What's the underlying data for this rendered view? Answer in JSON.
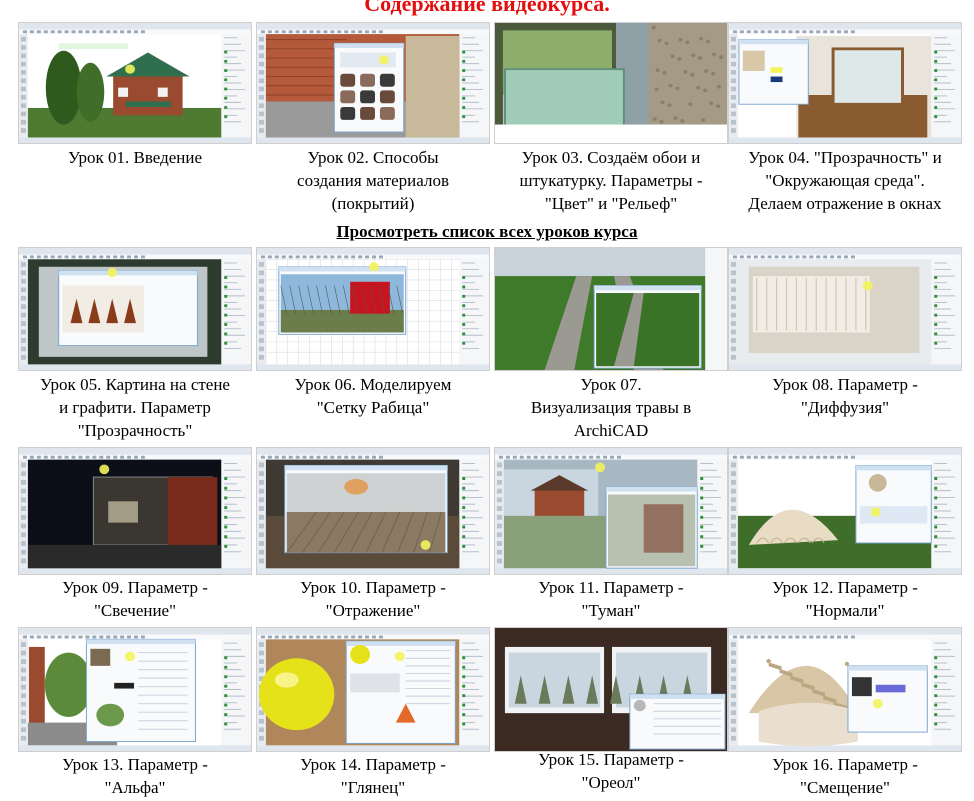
{
  "title": "Содержание видеокурса.",
  "all_lessons_link": "Просмотреть список всех уроков курса",
  "lessons": [
    {
      "number": "01",
      "lines": [
        "Урок 01. Введение"
      ]
    },
    {
      "number": "02",
      "lines": [
        "Урок 02. Способы",
        "создания материалов",
        "(покрытий)"
      ]
    },
    {
      "number": "03",
      "lines": [
        "Урок 03. Создаём обои и",
        "штукатурку.  Параметры -",
        "\"Цвет\" и \"Рельеф\""
      ]
    },
    {
      "number": "04",
      "lines": [
        "Урок 04. \"Прозрачность\" и",
        "\"Окружающая среда\".",
        "Делаем отражение в окнах"
      ]
    },
    {
      "number": "05",
      "lines": [
        "Урок 05. Картина на стене",
        "и графити. Параметр",
        "\"Прозрачность\""
      ]
    },
    {
      "number": "06",
      "lines": [
        "Урок 06. Моделируем",
        "\"Сетку Рабица\""
      ]
    },
    {
      "number": "07",
      "lines": [
        "Урок 07.",
        "Визуализация  травы в",
        "ArchiCAD"
      ]
    },
    {
      "number": "08",
      "lines": [
        "Урок 08. Параметр -",
        "\"Диффузия\""
      ]
    },
    {
      "number": "09",
      "lines": [
        "Урок 09. Параметр -",
        "\"Свечение\""
      ]
    },
    {
      "number": "10",
      "lines": [
        "Урок 10. Параметр -",
        "\"Отражение\""
      ]
    },
    {
      "number": "11",
      "lines": [
        "Урок 11. Параметр -",
        "\"Туман\""
      ]
    },
    {
      "number": "12",
      "lines": [
        "Урок 12. Параметр -",
        "\"Нормали\""
      ]
    },
    {
      "number": "13",
      "lines": [
        "Урок 13. Параметр -",
        "\"Альфа\""
      ]
    },
    {
      "number": "14",
      "lines": [
        "Урок 14. Параметр -",
        "\"Глянец\""
      ]
    },
    {
      "number": "15",
      "lines": [
        "Урок 15. Параметр -",
        "\"Ореол\""
      ]
    },
    {
      "number": "16",
      "lines": [
        "Урок 16. Параметр -",
        "\"Смещение\""
      ]
    }
  ],
  "colors": {
    "title": "#e30f0f",
    "app_chrome": "#dfe6ee",
    "highlight": "#f3f35a"
  }
}
